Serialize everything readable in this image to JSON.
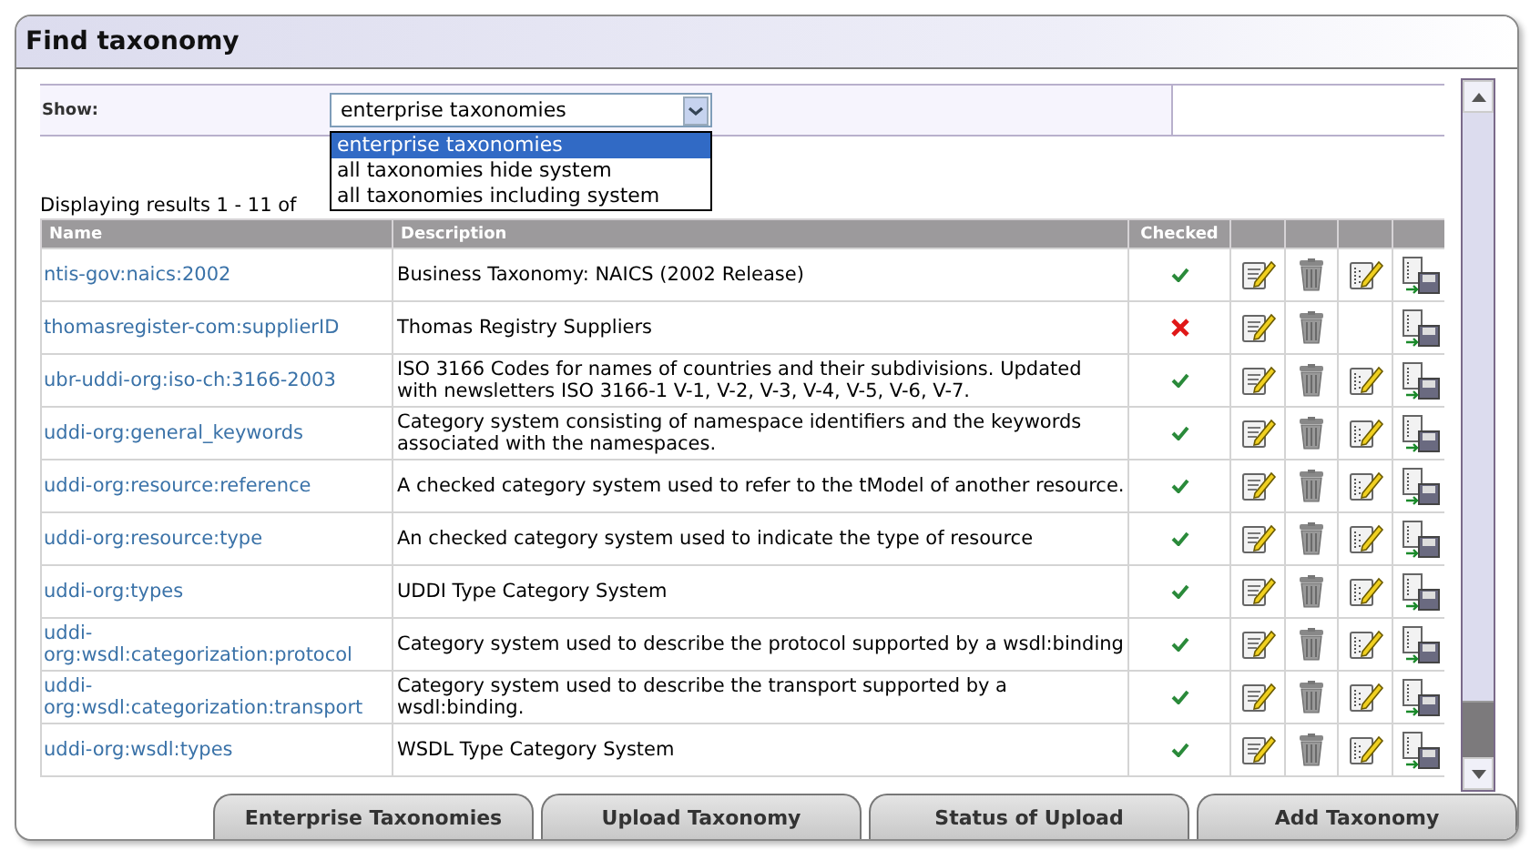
{
  "window": {
    "title": "Find taxonomy"
  },
  "filter": {
    "label": "Show:",
    "value": "enterprise taxonomies",
    "options": [
      {
        "label": "enterprise taxonomies",
        "selected": true
      },
      {
        "label": "all taxonomies hide system",
        "selected": false
      },
      {
        "label": "all taxonomies including system",
        "selected": false
      }
    ]
  },
  "results_summary": "Displaying results 1 - 11 of",
  "table": {
    "columns": [
      "Name",
      "Description",
      "Checked"
    ],
    "rows": [
      {
        "name": "ntis-gov:naics:2002",
        "description": "Business Taxonomy: NAICS (2002 Release)",
        "checked": true,
        "schema_editable": true
      },
      {
        "name": "thomasregister-com:supplierID",
        "description": "Thomas Registry Suppliers",
        "checked": false,
        "schema_editable": false
      },
      {
        "name": "ubr-uddi-org:iso-ch:3166-2003",
        "description": "ISO 3166 Codes for names of countries and their subdivisions. Updated with newsletters ISO 3166-1 V-1, V-2, V-3, V-4, V-5, V-6, V-7.",
        "checked": true,
        "schema_editable": true
      },
      {
        "name": "uddi-org:general_keywords",
        "description": "Category system consisting of namespace identifiers and the keywords associated with the namespaces.",
        "checked": true,
        "schema_editable": true
      },
      {
        "name": "uddi-org:resource:reference",
        "description": "A checked category system used to refer to the tModel of another resource.",
        "checked": true,
        "schema_editable": true
      },
      {
        "name": "uddi-org:resource:type",
        "description": "An checked category system used to indicate the type of resource",
        "checked": true,
        "schema_editable": true
      },
      {
        "name": "uddi-org:types",
        "description": "UDDI Type Category System",
        "checked": true,
        "schema_editable": true
      },
      {
        "name": "uddi-org:wsdl:categorization:protocol",
        "description": "Category system used to describe the protocol supported by a wsdl:binding",
        "checked": true,
        "schema_editable": true
      },
      {
        "name": "uddi-org:wsdl:categorization:transport",
        "description": "Category system used to describe the transport supported by a wsdl:binding.",
        "checked": true,
        "schema_editable": true
      },
      {
        "name": "uddi-org:wsdl:types",
        "description": "WSDL Type Category System",
        "checked": true,
        "schema_editable": true
      }
    ]
  },
  "bottom_tabs": [
    "Enterprise Taxonomies",
    "Upload Taxonomy",
    "Status of Upload",
    "Add Taxonomy"
  ]
}
